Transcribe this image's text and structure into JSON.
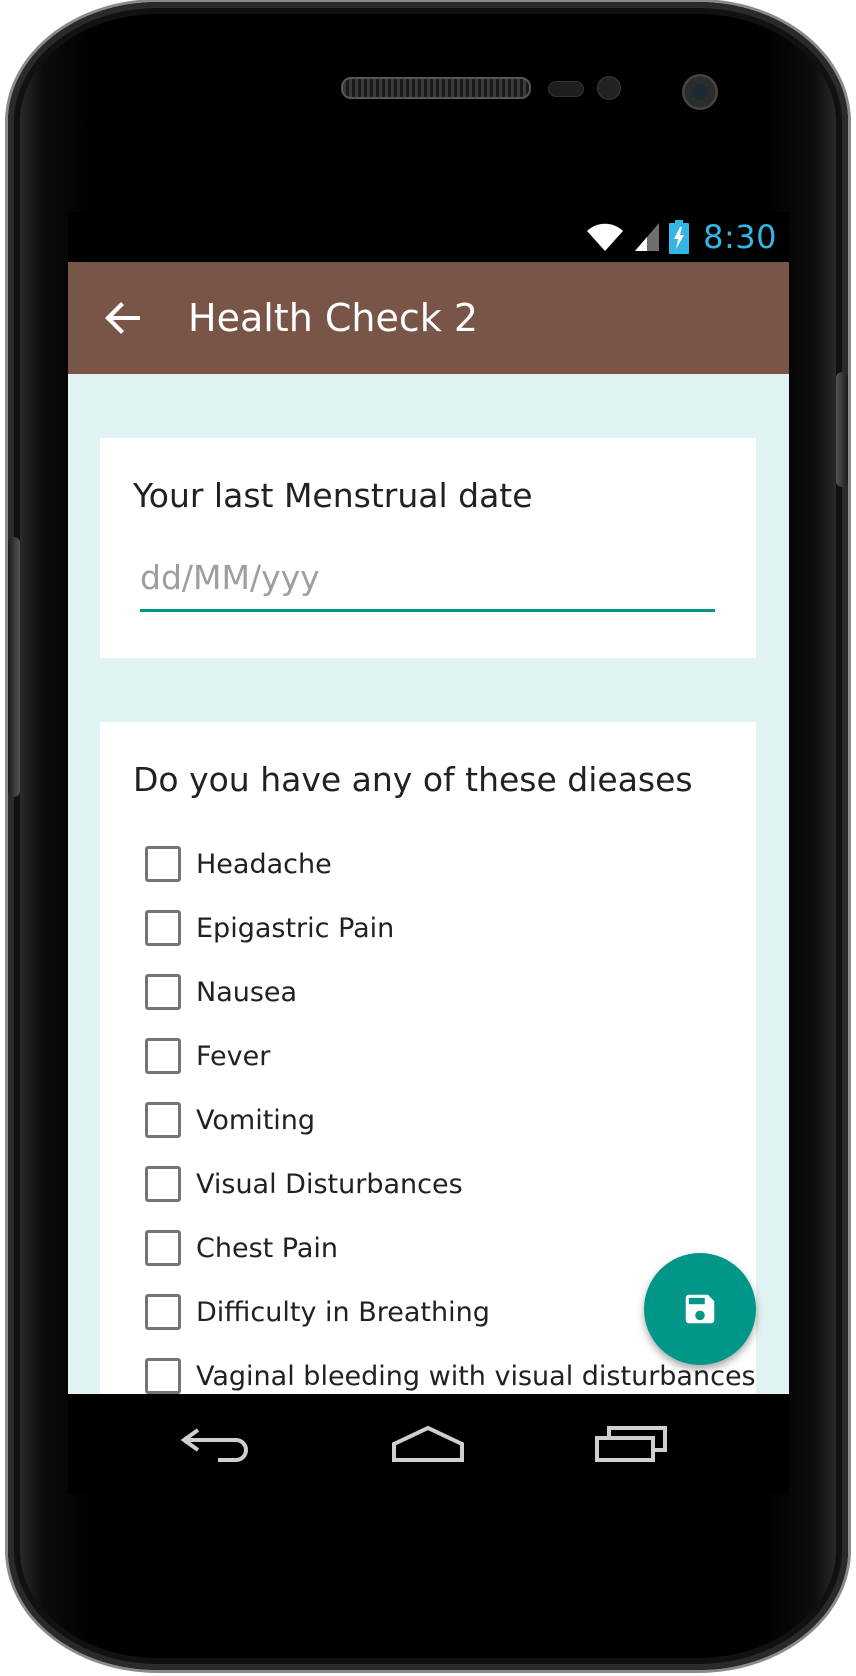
{
  "status_bar": {
    "time": "8:30",
    "icons": [
      "wifi-icon",
      "cell-signal-icon",
      "battery-charging-icon"
    ],
    "time_color": "#33b5e5"
  },
  "app_bar": {
    "title": "Health Check 2",
    "back_icon": "arrow-back-icon",
    "color": "#795548"
  },
  "date_card": {
    "title": "Your last Menstrual date",
    "input": {
      "value": "",
      "placeholder": "dd/MM/yyy"
    },
    "accent": "#009688"
  },
  "disease_card": {
    "title": "Do you have any of these dieases",
    "items": [
      {
        "label": "Headache",
        "checked": false
      },
      {
        "label": "Epigastric Pain",
        "checked": false
      },
      {
        "label": "Nausea",
        "checked": false
      },
      {
        "label": "Fever",
        "checked": false
      },
      {
        "label": "Vomiting",
        "checked": false
      },
      {
        "label": "Visual Disturbances",
        "checked": false
      },
      {
        "label": "Chest Pain",
        "checked": false
      },
      {
        "label": "Difficulty in Breathing",
        "checked": false
      },
      {
        "label": "Vaginal bleeding with visual disturbances",
        "checked": false
      }
    ]
  },
  "fab": {
    "icon": "save-icon",
    "color": "#009688"
  },
  "nav_bar": {
    "icons": [
      "nav-back-icon",
      "nav-home-icon",
      "nav-recents-icon"
    ]
  },
  "colors": {
    "background": "#e0f2f1",
    "card": "#ffffff"
  }
}
